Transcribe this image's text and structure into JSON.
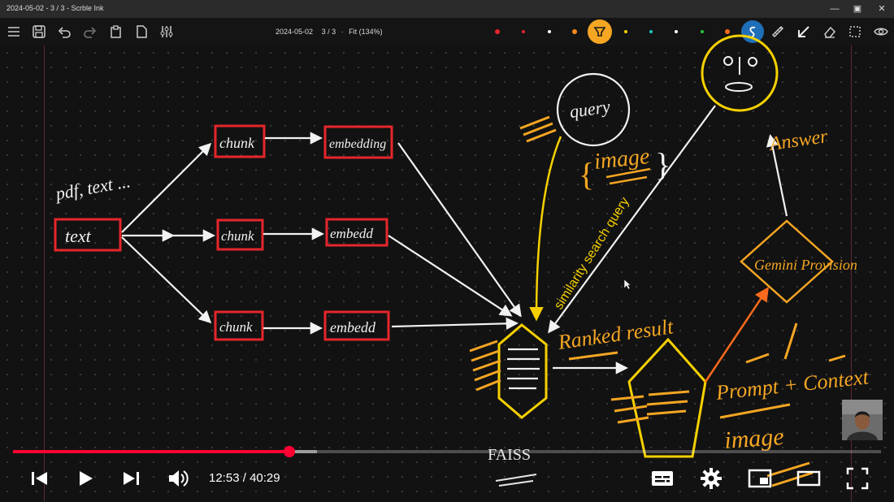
{
  "window": {
    "title": "2024-05-02 - 3 / 3 - Scrble Ink",
    "controls": [
      "minimize",
      "maximize",
      "close"
    ]
  },
  "toolbar": {
    "doc_date": "2024-05-02",
    "page": "3 / 3",
    "separator": "·",
    "zoom": "Fit (134%)",
    "icons": [
      "menu-icon",
      "save-icon",
      "undo-icon",
      "redo-icon",
      "paste-icon",
      "page-icon",
      "sliders-icon"
    ],
    "pen_colors": [
      "#e5262b",
      "#e5262b",
      "#ffffff",
      "#ff8a1c",
      "#f5a623",
      "#f5d000",
      "#18c6c6",
      "#ffffff",
      "#27c43a",
      "#ff6a1c"
    ],
    "right_tools": [
      "highlighter-icon",
      "scrble-icon",
      "ruler-icon",
      "arrow-icon",
      "eraser-icon",
      "select-icon",
      "eye-icon"
    ]
  },
  "sketch": {
    "text_label": "pdf, text ...",
    "text_box": "text",
    "chunks": [
      "chunk",
      "chunk",
      "chunk"
    ],
    "embeds": [
      "embedding",
      "embedd",
      "embedd"
    ],
    "query": "query",
    "image": "image",
    "similarity": "similarity search  query",
    "ranked": "Ranked result",
    "answer": "Answer",
    "gemini": "Gemini Provision",
    "prompt": "Prompt + Context",
    "image2": "image",
    "faiss": "FAISS"
  },
  "player": {
    "time_current": "12:53",
    "time_total": "40:29",
    "time_sep": " / ",
    "played_fraction": 0.318,
    "buffered_fraction": 0.35,
    "controls": [
      "previous-icon",
      "play-icon",
      "next-icon",
      "volume-icon",
      "captions-icon",
      "settings-icon",
      "miniplayer-icon",
      "theater-icon",
      "fullscreen-icon"
    ]
  }
}
